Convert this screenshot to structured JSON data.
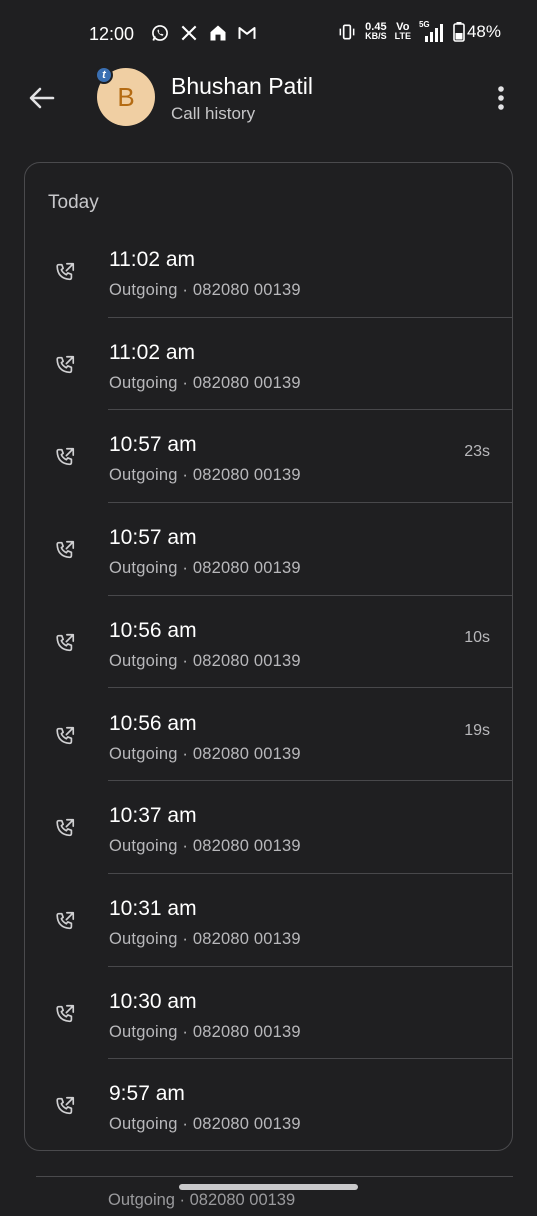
{
  "status_bar": {
    "time": "12:00",
    "left_icons": [
      "whatsapp-icon",
      "x-icon",
      "home-icon",
      "gmail-icon"
    ],
    "speed_value": "0.45",
    "speed_unit": "KB/S",
    "volte_top": "Vo",
    "volte_bottom": "LTE",
    "network": "5G",
    "battery": "48%"
  },
  "header": {
    "contact_name": "Bhushan Patil",
    "subtitle": "Call history",
    "avatar_letter": "B",
    "avatar_badge": "t",
    "avatar_color": "#f0cfa3"
  },
  "section": {
    "label": "Today"
  },
  "calls": [
    {
      "time": "11:02 am",
      "detail": "Outgoing · 082080 00139",
      "duration": ""
    },
    {
      "time": "11:02 am",
      "detail": "Outgoing · 082080 00139",
      "duration": ""
    },
    {
      "time": "10:57 am",
      "detail": "Outgoing · 082080 00139",
      "duration": "23s"
    },
    {
      "time": "10:57 am",
      "detail": "Outgoing · 082080 00139",
      "duration": ""
    },
    {
      "time": "10:56 am",
      "detail": "Outgoing · 082080 00139",
      "duration": "10s"
    },
    {
      "time": "10:56 am",
      "detail": "Outgoing · 082080 00139",
      "duration": "19s"
    },
    {
      "time": "10:37 am",
      "detail": "Outgoing · 082080 00139",
      "duration": ""
    },
    {
      "time": "10:31 am",
      "detail": "Outgoing · 082080 00139",
      "duration": ""
    },
    {
      "time": "10:30 am",
      "detail": "Outgoing · 082080 00139",
      "duration": ""
    },
    {
      "time": "9:57 am",
      "detail": "Outgoing · 082080 00139",
      "duration": ""
    }
  ],
  "peek": {
    "detail": "Outgoing · 082080 00139"
  }
}
